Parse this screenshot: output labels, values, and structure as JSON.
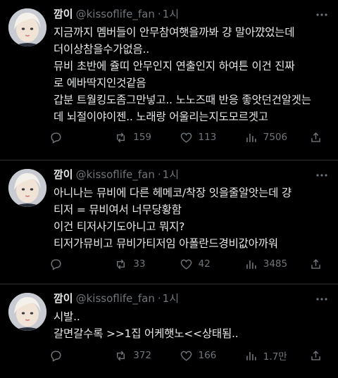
{
  "tweets": [
    {
      "display_name": "깜이",
      "handle": "@kissoflife_fan",
      "separator": "·",
      "time": "1시",
      "text": "지금까지 멤버들이 안무참여햇을까봐 걍 말아꺘었는데\n더이상참을수가없음..\n뮤비 초반에 쥴띠 안무인지 연출인지 하여튼 이건 진짜\n로 에바딱지인것같음\n갑분 트월킹도좀그만넣고.. 노노즈때 반응 좋앗던건알겟는\n데 뇌절이야이젠.. 노래랑 어울리는지도모르겟고",
      "replies": "",
      "retweets": "159",
      "likes": "113",
      "views": "7506"
    },
    {
      "display_name": "깜이",
      "handle": "@kissoflife_fan",
      "separator": "·",
      "time": "1시",
      "text": "아니나는 뮤비에 다른 헤메코/착장 잇을줄알앗는데 걍\n티저 = 뮤비여서 너무당황함\n이건 티저사기도아니고 뭐지?\n티저가뮤비고 뮤비가티저임 아폴란드경비값아까워",
      "replies": "",
      "retweets": "33",
      "likes": "42",
      "views": "3485"
    },
    {
      "display_name": "깜이",
      "handle": "@kissoflife_fan",
      "separator": "·",
      "time": "1시",
      "text": "시발..\n갈면갈수록 >>1집 어케햇노<<상태됨..",
      "replies": "",
      "retweets": "372",
      "likes": "166",
      "views": "1.7만"
    }
  ],
  "icons": [
    "more-icon",
    "reply-icon",
    "retweet-icon",
    "like-icon",
    "views-icon",
    "share-icon"
  ],
  "colors": {
    "background": "#000000",
    "text": "#e7e9ea",
    "muted": "#71767b",
    "divider": "#2f3336"
  }
}
